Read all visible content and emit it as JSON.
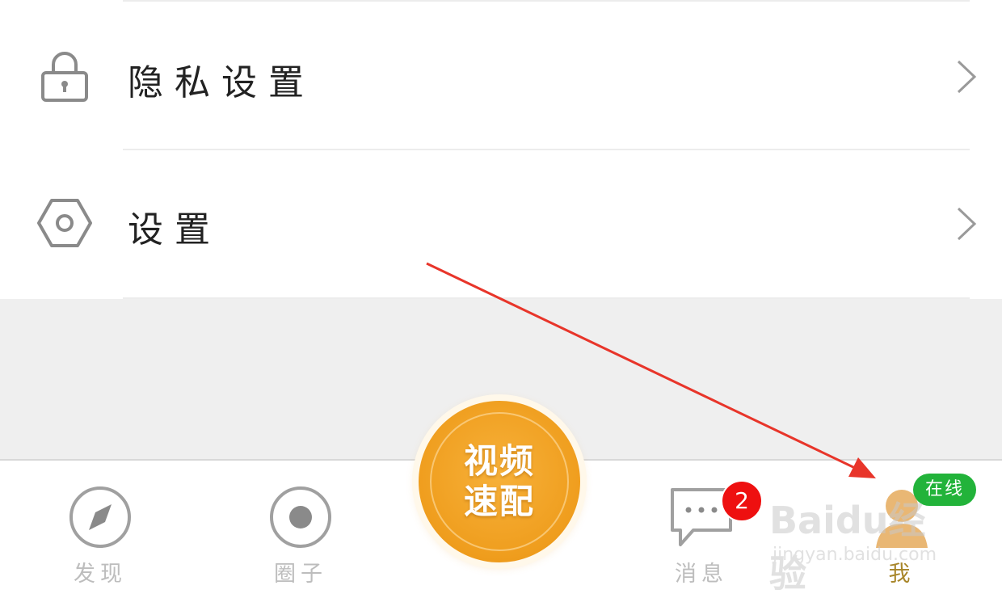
{
  "menu": {
    "items": [
      {
        "label": "隐私设置",
        "icon": "lock-icon"
      },
      {
        "label": "设置",
        "icon": "hexagon-settings-icon"
      }
    ]
  },
  "center_button": {
    "line1": "视频",
    "line2": "速配"
  },
  "tabbar": {
    "tabs": [
      {
        "label": "发现",
        "icon": "compass-icon"
      },
      {
        "label": "圈子",
        "icon": "circle-dot-icon"
      },
      {
        "label": "消息",
        "icon": "chat-bubble-icon",
        "badge": "2"
      },
      {
        "label": "我",
        "icon": "user-icon",
        "status": "在线"
      }
    ]
  },
  "watermark": {
    "main": "Baidu经验",
    "sub": "jingyan.baidu.com"
  },
  "colors": {
    "accent_orange": "#ef9d1d",
    "badge_red": "#ee1010",
    "online_green": "#22b33a",
    "active_tab": "#a8862a",
    "annotation_arrow": "#e8352a"
  }
}
